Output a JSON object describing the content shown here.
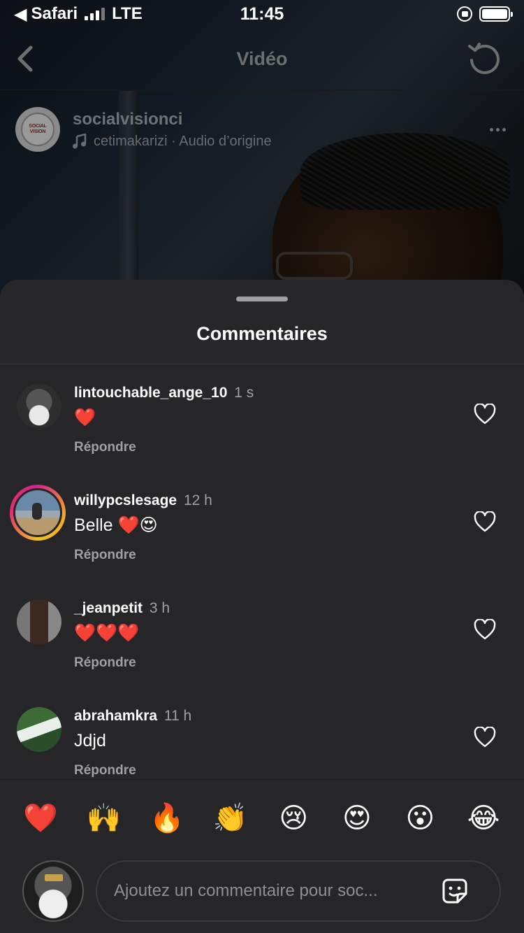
{
  "status_bar": {
    "back_app": "Safari",
    "carrier": "LTE",
    "time": "11:45"
  },
  "nav": {
    "title": "Vidéo"
  },
  "post": {
    "username": "socialvisionci",
    "audio": "cetimakarizi · Audio d’origine",
    "avatar_logo_text": "SOCIAL VISION"
  },
  "sheet": {
    "title": "Commentaires"
  },
  "comments": [
    {
      "username": "lintouchable_ange_10",
      "time": "1 s",
      "text": "❤️",
      "reply_label": "Répondre"
    },
    {
      "username": "willypcslesage",
      "time": "12 h",
      "text": "Belle ❤️😍",
      "reply_label": "Répondre"
    },
    {
      "username": "_jeanpetit",
      "time": "3 h",
      "text": "❤️❤️❤️",
      "reply_label": "Répondre"
    },
    {
      "username": "abrahamkra",
      "time": "11 h",
      "text": "Jdjd",
      "reply_label": "Répondre"
    }
  ],
  "emoji_bar": [
    "❤️",
    "🙌",
    "🔥",
    "👏",
    "😢",
    "😍",
    "😮",
    "😂"
  ],
  "composer": {
    "placeholder": "Ajoutez un commentaire pour soc..."
  },
  "colors": {
    "sheet_bg": "#262629",
    "secondary_text": "#a0a0a4",
    "story_ring_start": "#d6248a",
    "story_ring_end": "#f5a623"
  }
}
